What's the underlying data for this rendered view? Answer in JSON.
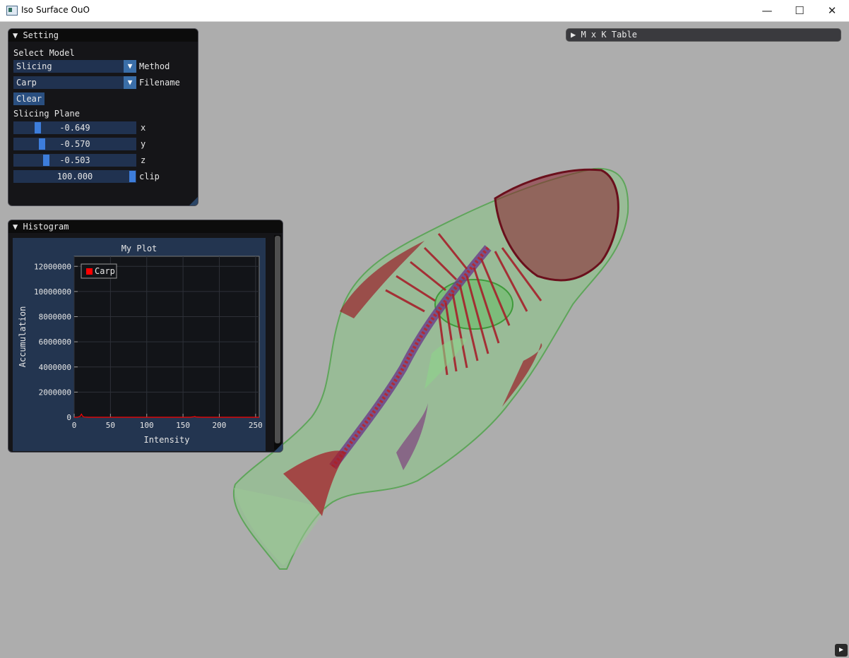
{
  "window": {
    "title": "Iso Surface OuO",
    "minimize": "—",
    "maximize": "☐",
    "close": "✕"
  },
  "setting": {
    "header": "▼ Setting",
    "select_model_label": "Select Model",
    "method_value": "Slicing",
    "method_label": "Method",
    "filename_value": "Carp",
    "filename_label": "Filename",
    "clear_label": "Clear",
    "slicing_plane_label": "Slicing Plane",
    "sliders": [
      {
        "label": "x",
        "value": "-0.649",
        "level": 0.175
      },
      {
        "label": "y",
        "value": "-0.570",
        "level": 0.215
      },
      {
        "label": "z",
        "value": "-0.503",
        "level": 0.25
      },
      {
        "label": "clip",
        "value": "100.000",
        "level": 1.0
      }
    ]
  },
  "histogram": {
    "header": "▼ Histogram"
  },
  "mk_table": {
    "header": "▶ M x K Table"
  },
  "corner_button": "▶",
  "chart_data": {
    "type": "line",
    "title": "My Plot",
    "xlabel": "Intensity",
    "ylabel": "Accumulation",
    "xlim": [
      0,
      255
    ],
    "ylim": [
      0,
      12800000
    ],
    "xticks": [
      0,
      50,
      100,
      150,
      200,
      250
    ],
    "yticks": [
      0,
      2000000,
      4000000,
      6000000,
      8000000,
      10000000,
      12000000
    ],
    "xtick_labels": [
      "0",
      "50",
      "100",
      "150",
      "200",
      "250"
    ],
    "ytick_labels": [
      "0",
      "2000000",
      "4000000",
      "6000000",
      "8000000",
      "10000000",
      "12000000"
    ],
    "grid": true,
    "legend_position": "top-left",
    "series": [
      {
        "name": "Carp",
        "color": "#ff0000",
        "x": [
          0,
          5,
          8,
          10,
          11,
          12,
          14,
          20,
          60,
          100,
          150,
          160,
          165,
          166,
          168,
          175,
          200,
          255
        ],
        "y": [
          0,
          10000,
          60000,
          250000,
          150000,
          60000,
          15000,
          0,
          0,
          0,
          0,
          0,
          40000,
          60000,
          20000,
          0,
          0,
          0
        ]
      }
    ]
  },
  "colors": {
    "panel_bg": "#0f0f12",
    "frame_bg": "#203250",
    "accent": "#3d7ddb",
    "bone": "#a5202a",
    "flesh": "#7cbf74"
  }
}
